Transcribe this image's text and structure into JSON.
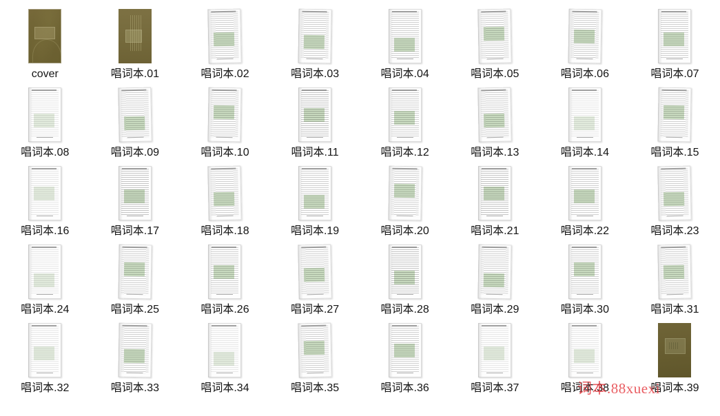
{
  "gallery": {
    "columns": 8,
    "rows": 5,
    "background_color": "#ffffff",
    "label_color": "#141414",
    "items": [
      {
        "label": "cover",
        "thumb_style": "cover-a"
      },
      {
        "label": "唱词本.01",
        "thumb_style": "cover-b"
      },
      {
        "label": "唱词本.02",
        "thumb_style": "page tilt"
      },
      {
        "label": "唱词本.03",
        "thumb_style": "page tilt2"
      },
      {
        "label": "唱词本.04",
        "thumb_style": "page"
      },
      {
        "label": "唱词本.05",
        "thumb_style": "page tilt"
      },
      {
        "label": "唱词本.06",
        "thumb_style": "page tilt2"
      },
      {
        "label": "唱词本.07",
        "thumb_style": "page"
      },
      {
        "label": "唱词本.08",
        "thumb_style": "page faint"
      },
      {
        "label": "唱词本.09",
        "thumb_style": "page tilt"
      },
      {
        "label": "唱词本.10",
        "thumb_style": "page tilt2"
      },
      {
        "label": "唱词本.11",
        "thumb_style": "page dark"
      },
      {
        "label": "唱词本.12",
        "thumb_style": "page"
      },
      {
        "label": "唱词本.13",
        "thumb_style": "page tilt"
      },
      {
        "label": "唱词本.14",
        "thumb_style": "page faint"
      },
      {
        "label": "唱词本.15",
        "thumb_style": "page tilt2"
      },
      {
        "label": "唱词本.16",
        "thumb_style": "page faint"
      },
      {
        "label": "唱词本.17",
        "thumb_style": "page dark"
      },
      {
        "label": "唱词本.18",
        "thumb_style": "page tilt"
      },
      {
        "label": "唱词本.19",
        "thumb_style": "page"
      },
      {
        "label": "唱词本.20",
        "thumb_style": "page tilt2"
      },
      {
        "label": "唱词本.21",
        "thumb_style": "page dark"
      },
      {
        "label": "唱词本.22",
        "thumb_style": "page"
      },
      {
        "label": "唱词本.23",
        "thumb_style": "page tilt"
      },
      {
        "label": "唱词本.24",
        "thumb_style": "page faint"
      },
      {
        "label": "唱词本.25",
        "thumb_style": "page tilt2"
      },
      {
        "label": "唱词本.26",
        "thumb_style": "page"
      },
      {
        "label": "唱词本.27",
        "thumb_style": "page tilt"
      },
      {
        "label": "唱词本.28",
        "thumb_style": "page dark"
      },
      {
        "label": "唱词本.29",
        "thumb_style": "page tilt2"
      },
      {
        "label": "唱词本.30",
        "thumb_style": "page"
      },
      {
        "label": "唱词本.31",
        "thumb_style": "page tilt"
      },
      {
        "label": "唱词本.32",
        "thumb_style": "page faint"
      },
      {
        "label": "唱词本.33",
        "thumb_style": "page tilt2"
      },
      {
        "label": "唱词本.34",
        "thumb_style": "page faint"
      },
      {
        "label": "唱词本.35",
        "thumb_style": "page tilt"
      },
      {
        "label": "唱词本.36",
        "thumb_style": "page"
      },
      {
        "label": "唱词本.37",
        "thumb_style": "page faint"
      },
      {
        "label": "唱词本.38",
        "thumb_style": "page faint"
      },
      {
        "label": "唱词本.39",
        "thumb_style": "cover-c"
      }
    ]
  },
  "watermark": {
    "text": "词本.88xuexi",
    "color": "#e4343a"
  }
}
